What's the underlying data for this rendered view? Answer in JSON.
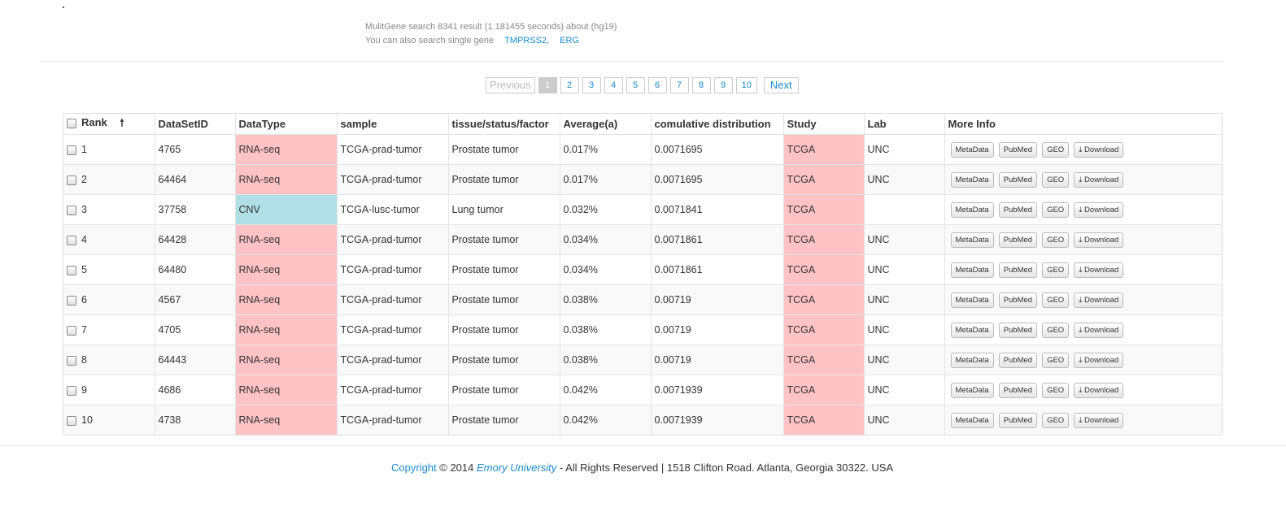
{
  "search": {
    "summary": "MulitGene search 8341 result (1.181455 seconds) about (hg19)",
    "single_gene_text": "You can also search single gene",
    "genes": [
      "TMPRSS2,",
      "ERG"
    ]
  },
  "pagination": {
    "previous": "Previous",
    "pages": [
      "1",
      "2",
      "3",
      "4",
      "5",
      "6",
      "7",
      "8",
      "9",
      "10"
    ],
    "active": "1",
    "next": "Next"
  },
  "table": {
    "headers": {
      "rank": "Rank",
      "dataset": "DataSetID",
      "datatype": "DataType",
      "sample": "sample",
      "tissue": "tissue/status/factor",
      "average": "Average(a)",
      "cumulative": "comulative distribution",
      "study": "Study",
      "lab": "Lab",
      "more": "More Info"
    },
    "buttons": {
      "metadata": "MetaData",
      "pubmed": "PubMed",
      "geo": "GEO",
      "download": "Download"
    },
    "rows": [
      {
        "rank": "1",
        "dataset": "4765",
        "datatype": "RNA-seq",
        "sample": "TCGA-prad-tumor",
        "tissue": "Prostate tumor",
        "average": "0.017%",
        "cumulative": "0.0071695",
        "study": "TCGA",
        "lab": "UNC"
      },
      {
        "rank": "2",
        "dataset": "64464",
        "datatype": "RNA-seq",
        "sample": "TCGA-prad-tumor",
        "tissue": "Prostate tumor",
        "average": "0.017%",
        "cumulative": "0.0071695",
        "study": "TCGA",
        "lab": "UNC"
      },
      {
        "rank": "3",
        "dataset": "37758",
        "datatype": "CNV",
        "sample": "TCGA-lusc-tumor",
        "tissue": "Lung tumor",
        "average": "0.032%",
        "cumulative": "0.0071841",
        "study": "TCGA",
        "lab": ""
      },
      {
        "rank": "4",
        "dataset": "64428",
        "datatype": "RNA-seq",
        "sample": "TCGA-prad-tumor",
        "tissue": "Prostate tumor",
        "average": "0.034%",
        "cumulative": "0.0071861",
        "study": "TCGA",
        "lab": "UNC"
      },
      {
        "rank": "5",
        "dataset": "64480",
        "datatype": "RNA-seq",
        "sample": "TCGA-prad-tumor",
        "tissue": "Prostate tumor",
        "average": "0.034%",
        "cumulative": "0.0071861",
        "study": "TCGA",
        "lab": "UNC"
      },
      {
        "rank": "6",
        "dataset": "4567",
        "datatype": "RNA-seq",
        "sample": "TCGA-prad-tumor",
        "tissue": "Prostate tumor",
        "average": "0.038%",
        "cumulative": "0.00719",
        "study": "TCGA",
        "lab": "UNC"
      },
      {
        "rank": "7",
        "dataset": "4705",
        "datatype": "RNA-seq",
        "sample": "TCGA-prad-tumor",
        "tissue": "Prostate tumor",
        "average": "0.038%",
        "cumulative": "0.00719",
        "study": "TCGA",
        "lab": "UNC"
      },
      {
        "rank": "8",
        "dataset": "64443",
        "datatype": "RNA-seq",
        "sample": "TCGA-prad-tumor",
        "tissue": "Prostate tumor",
        "average": "0.038%",
        "cumulative": "0.00719",
        "study": "TCGA",
        "lab": "UNC"
      },
      {
        "rank": "9",
        "dataset": "4686",
        "datatype": "RNA-seq",
        "sample": "TCGA-prad-tumor",
        "tissue": "Prostate tumor",
        "average": "0.042%",
        "cumulative": "0.0071939",
        "study": "TCGA",
        "lab": "UNC"
      },
      {
        "rank": "10",
        "dataset": "4738",
        "datatype": "RNA-seq",
        "sample": "TCGA-prad-tumor",
        "tissue": "Prostate tumor",
        "average": "0.042%",
        "cumulative": "0.0071939",
        "study": "TCGA",
        "lab": "UNC"
      }
    ]
  },
  "footer": {
    "copyright_link": "Copyright",
    "year_text": "© 2014",
    "university": "Emory University",
    "rest": "- All Rights Reserved | 1518 Clifton Road. Atlanta, Georgia 30322. USA"
  },
  "colors": {
    "link": "#1a8ad1",
    "rna_seq_cell": "#ffc3c6",
    "cnv_cell": "#b0e0e6",
    "study_cell": "#ffc3c6"
  },
  "icons": {
    "sort": "arrow-up-icon",
    "download": "download-icon"
  }
}
